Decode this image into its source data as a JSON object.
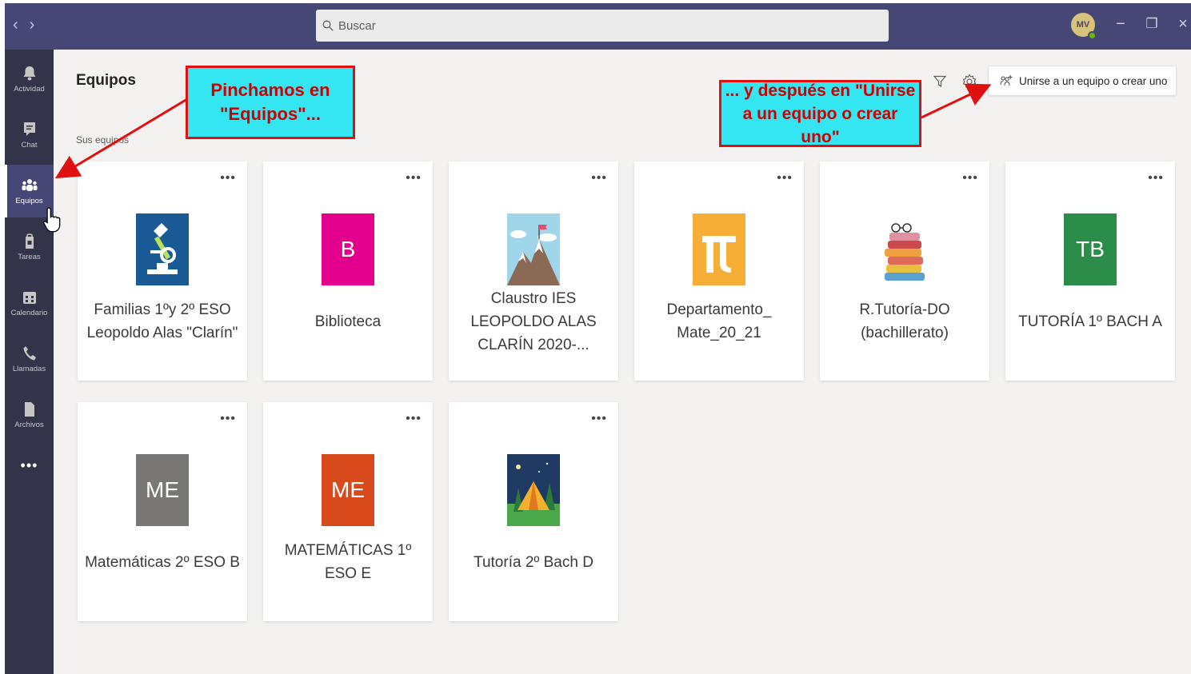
{
  "titlebar": {
    "back_glyph": "‹",
    "forward_glyph": "›",
    "search_placeholder": "Buscar",
    "avatar_initials": "MV",
    "minimize_glyph": "−",
    "restore_glyph": "❐",
    "close_glyph": "×",
    "accent_color": "#464775"
  },
  "appbar": {
    "items": [
      {
        "label": "Actividad",
        "icon": "bell-icon"
      },
      {
        "label": "Chat",
        "icon": "chat-icon"
      },
      {
        "label": "Equipos",
        "icon": "teams-icon",
        "active": true
      },
      {
        "label": "Tareas",
        "icon": "assignments-icon"
      },
      {
        "label": "Calendario",
        "icon": "calendar-icon"
      },
      {
        "label": "Llamadas",
        "icon": "phone-icon"
      },
      {
        "label": "Archivos",
        "icon": "file-icon"
      }
    ],
    "more_glyph": "•••"
  },
  "main": {
    "title": "Equipos",
    "section_label": "Sus equipos",
    "join_button": "Unirse a un equipo o crear uno",
    "teams": [
      {
        "name": "Familias 1ºy 2º ESO Leopoldo Alas \"Clarín\"",
        "tile": "microscope-image"
      },
      {
        "name": "Biblioteca",
        "tile_text": "B",
        "tile_color": "#e3008c"
      },
      {
        "name": "Claustro IES LEOPOLDO ALAS CLARÍN 2020-...",
        "tile": "mountain-image"
      },
      {
        "name": "Departamento_ Mate_20_21",
        "tile": "pi-image"
      },
      {
        "name": "R.Tutoría-DO (bachillerato)",
        "tile": "books-image"
      },
      {
        "name": "TUTORÍA 1º BACH A",
        "tile_text": "TB",
        "tile_color": "#2c8c4a"
      },
      {
        "name": "Matemáticas 2º ESO B",
        "tile_text": "ME",
        "tile_color": "#797775"
      },
      {
        "name": "MATEMÁTICAS 1º ESO E",
        "tile_text": "ME",
        "tile_color": "#d84a1b"
      },
      {
        "name": "Tutoría 2º Bach D",
        "tile": "tent-image"
      }
    ],
    "card_more_glyph": "•••"
  },
  "annotations": {
    "callout_left": "Pinchamos en \"Equipos\"...",
    "callout_right": "... y después en \"Unirse a un equipo o crear uno\"",
    "callout_bg": "#33e6f2",
    "callout_border": "#e01010"
  }
}
